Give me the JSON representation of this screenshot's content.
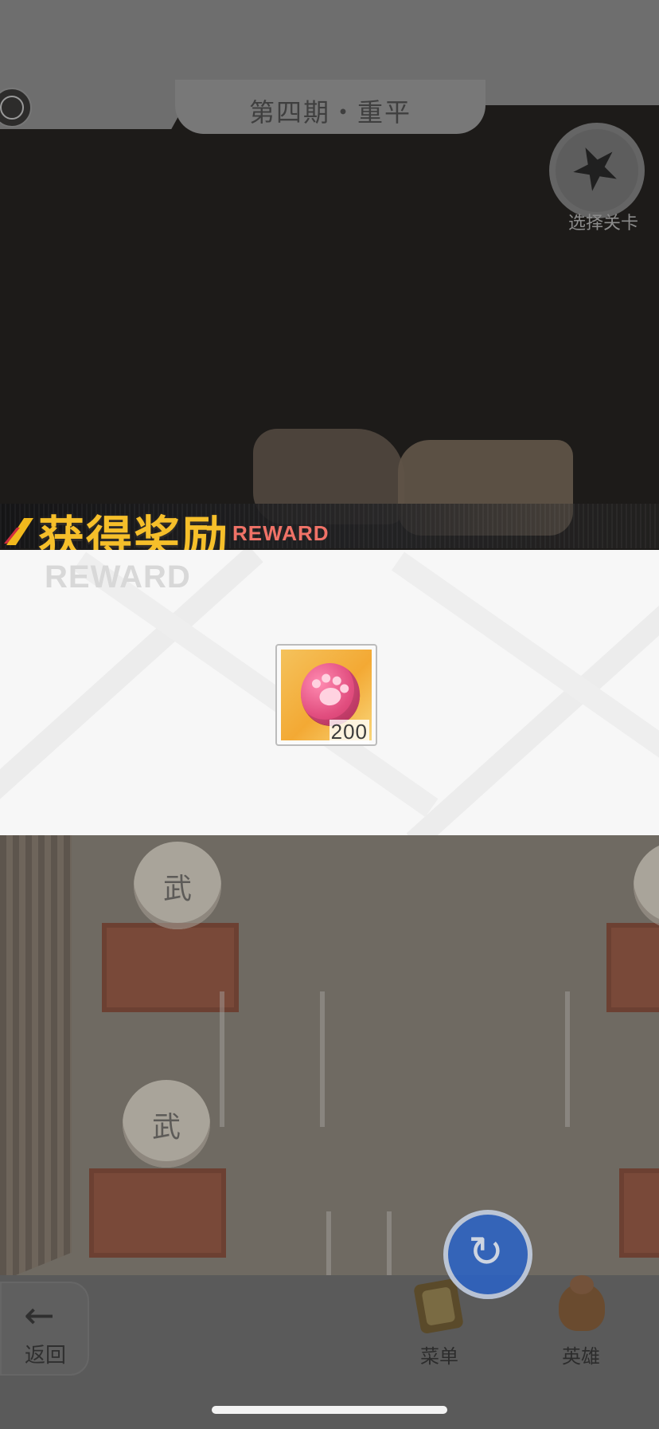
{
  "header": {
    "level_title": "第四期・重平",
    "badge_label": "选择关卡"
  },
  "reward": {
    "title": "获得奖励",
    "title_en": "REWARD",
    "watermark": "REWARD",
    "item": {
      "icon": "paw-coin-icon",
      "count": "200"
    }
  },
  "map": {
    "drum_char": "武"
  },
  "bottom_nav": {
    "back_label": "返回",
    "menu_label": "菜单",
    "hero_label": "英雄",
    "back_icon": "←",
    "refresh_icon": "↻"
  },
  "colors": {
    "reward_gold": "#f6bf2a",
    "reward_red": "#f07267",
    "refresh_blue": "#2a63c8",
    "item_pink": "#e24f80"
  }
}
